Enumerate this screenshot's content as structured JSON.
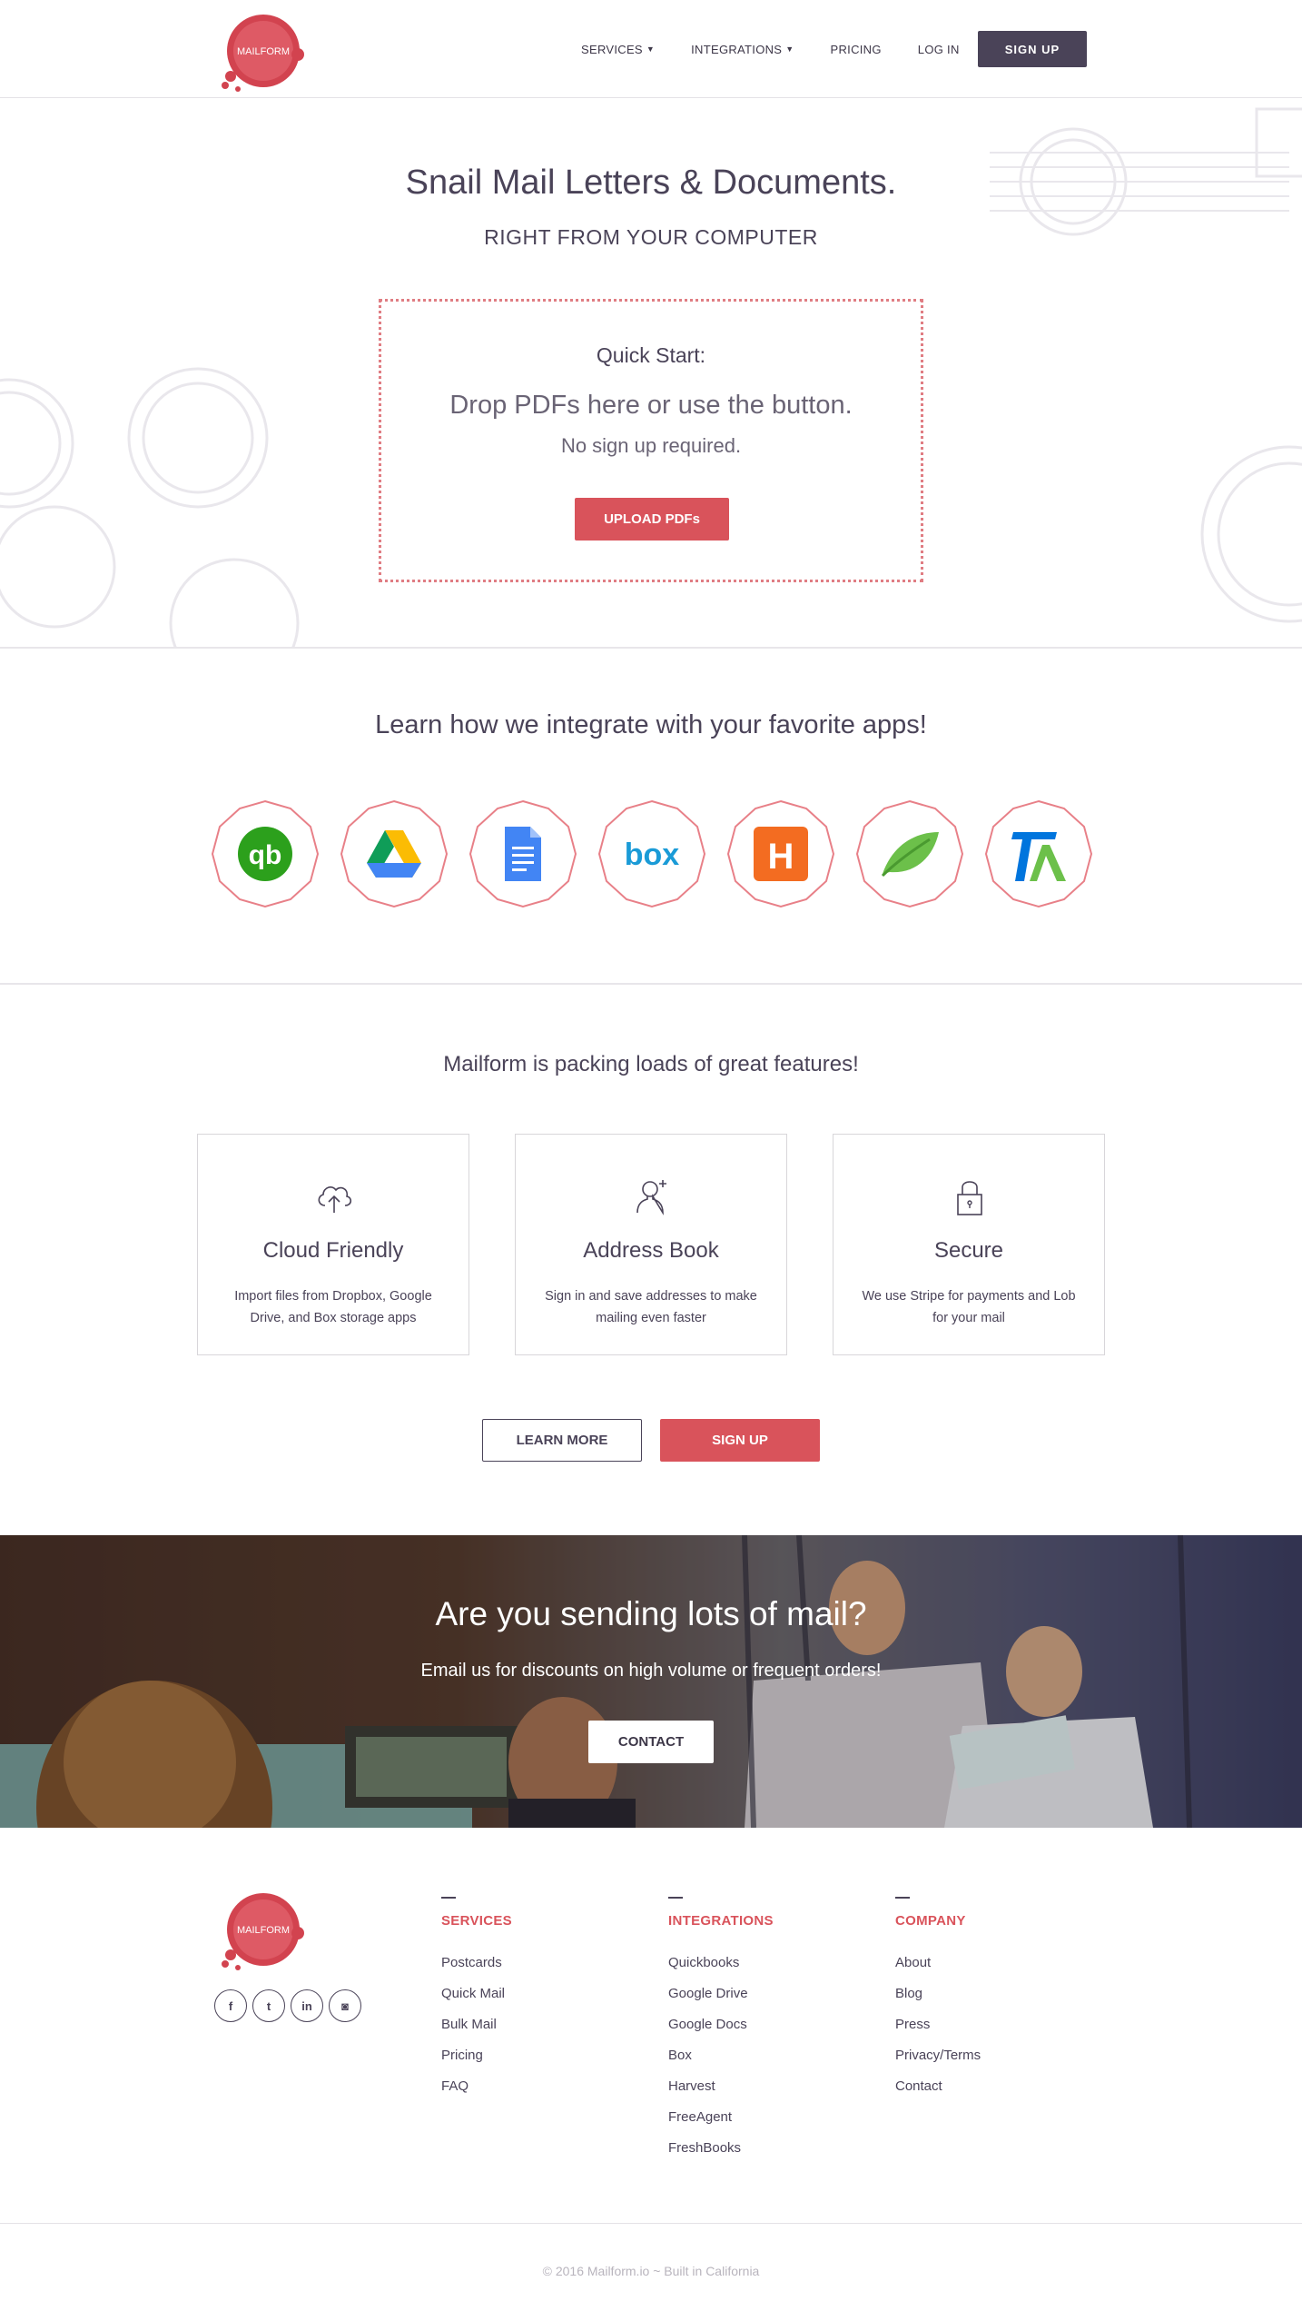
{
  "brand": {
    "logo_text": "MAILFORM",
    "accent": "#d9535b",
    "dark": "#4a4358"
  },
  "nav": {
    "items": [
      {
        "label": "SERVICES",
        "has_caret": true
      },
      {
        "label": "INTEGRATIONS",
        "has_caret": true
      },
      {
        "label": "PRICING",
        "has_caret": false
      },
      {
        "label": "LOG IN",
        "has_caret": false
      }
    ],
    "signup_label": "SIGN UP"
  },
  "hero": {
    "title": "Snail Mail Letters & Documents.",
    "subtitle": "RIGHT FROM YOUR COMPUTER",
    "quick_start": {
      "label": "Quick Start:",
      "drop_text": "Drop PDFs here or use the button.",
      "note": "No sign up required.",
      "upload_label": "UPLOAD PDFs"
    }
  },
  "integrations": {
    "title": "Learn how we integrate with your favorite apps!",
    "apps": [
      {
        "name": "quickbooks",
        "icon": "quickbooks-icon"
      },
      {
        "name": "google-drive",
        "icon": "google-drive-icon"
      },
      {
        "name": "google-docs",
        "icon": "google-docs-icon"
      },
      {
        "name": "box",
        "icon": "box-icon",
        "text": "box"
      },
      {
        "name": "harvest",
        "icon": "harvest-icon",
        "text": "H"
      },
      {
        "name": "freeagent",
        "icon": "freeagent-leaf-icon"
      },
      {
        "name": "freshbooks",
        "icon": "freshbooks-icon"
      }
    ]
  },
  "features": {
    "title": "Mailform is packing loads of great features!",
    "cards": [
      {
        "icon": "cloud-upload-icon",
        "title": "Cloud Friendly",
        "text": "Import files from Dropbox, Google Drive, and Box storage apps"
      },
      {
        "icon": "add-user-icon",
        "title": "Address Book",
        "text": "Sign in and save addresses to make mailing even faster"
      },
      {
        "icon": "lock-icon",
        "title": "Secure",
        "text": "We use Stripe for payments and Lob for your mail"
      }
    ],
    "learn_more_label": "LEARN MORE",
    "signup_label": "SIGN UP"
  },
  "bulk": {
    "title": "Are you sending lots of mail?",
    "subtitle": "Email us for discounts on high volume or frequent orders!",
    "contact_label": "CONTACT"
  },
  "footer": {
    "socials": [
      {
        "icon": "facebook-icon",
        "glyph": "f"
      },
      {
        "icon": "twitter-icon",
        "glyph": "t"
      },
      {
        "icon": "linkedin-icon",
        "glyph": "in"
      },
      {
        "icon": "instagram-icon",
        "glyph": "◙"
      }
    ],
    "columns": [
      {
        "heading": "SERVICES",
        "links": [
          "Postcards",
          "Quick Mail",
          "Bulk Mail",
          "Pricing",
          "FAQ"
        ]
      },
      {
        "heading": "INTEGRATIONS",
        "links": [
          "Quickbooks",
          "Google Drive",
          "Google Docs",
          "Box",
          "Harvest",
          "FreeAgent",
          "FreshBooks"
        ]
      },
      {
        "heading": "COMPANY",
        "links": [
          "About",
          "Blog",
          "Press",
          "Privacy/Terms",
          "Contact"
        ]
      }
    ],
    "copyright": "© 2016 Mailform.io ~ Built in California"
  }
}
